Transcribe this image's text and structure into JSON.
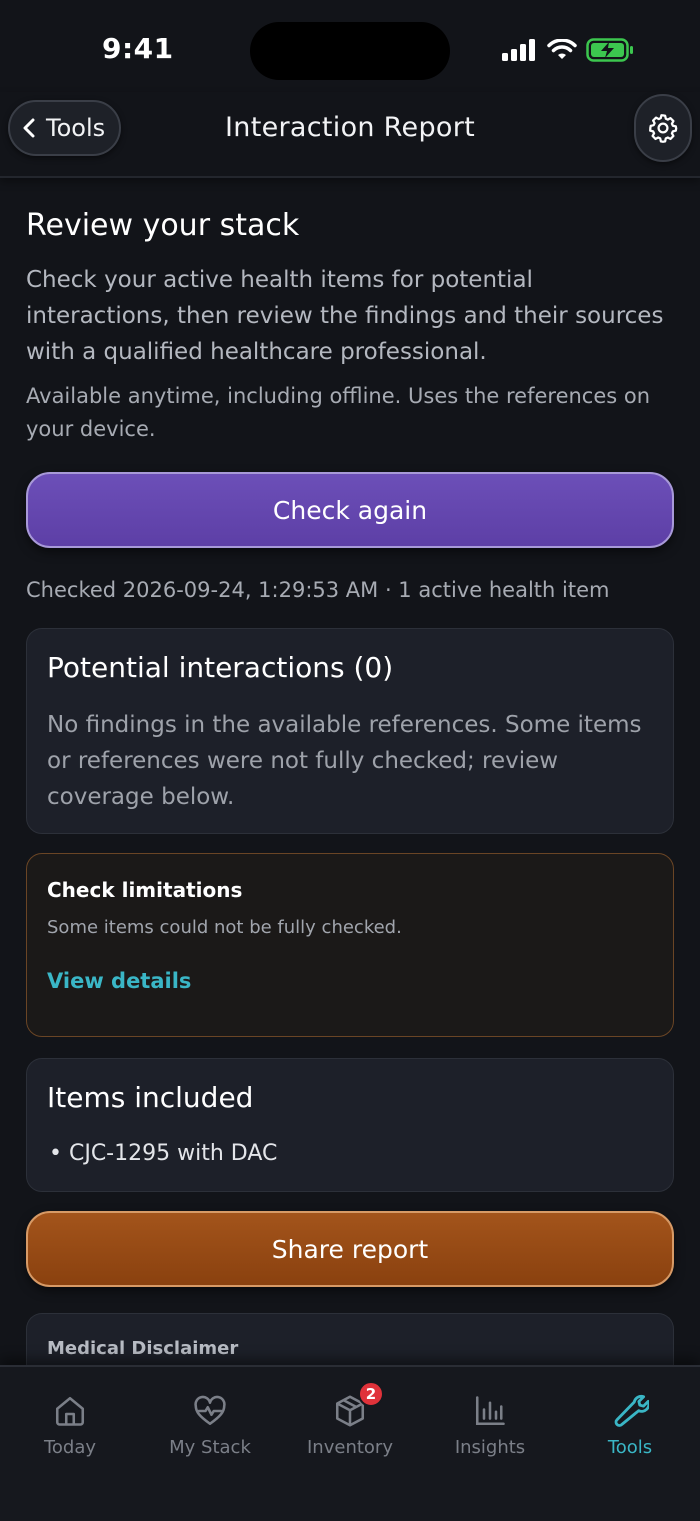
{
  "status_bar": {
    "time": "9:41"
  },
  "nav": {
    "back_label": "Tools",
    "title": "Interaction Report"
  },
  "main": {
    "heading": "Review your stack",
    "intro": "Check your active health items for potential interactions, then review the findings and their sources with a qualified healthcare professional.",
    "availability": "Available anytime, including offline. Uses the references on your device.",
    "check_button": "Check again",
    "checked_line": "Checked 2026-09-24, 1:29:53 AM · 1 active health item"
  },
  "interactions_card": {
    "title": "Potential interactions (0)",
    "body": "No findings in the available references. Some items or references were not fully checked; review coverage below."
  },
  "limitations_card": {
    "title": "Check limitations",
    "body": "Some items could not be fully checked.",
    "link": "View details"
  },
  "items_card": {
    "title": "Items included",
    "items": [
      "• CJC-1295 with DAC"
    ]
  },
  "share_button": "Share report",
  "disclaimer_card": {
    "title": "Medical Disclaimer"
  },
  "tabbar": {
    "tabs": [
      {
        "label": "Today",
        "icon": "home-icon",
        "active": false
      },
      {
        "label": "My Stack",
        "icon": "heart-pulse-icon",
        "active": false
      },
      {
        "label": "Inventory",
        "icon": "box-icon",
        "active": false,
        "badge": "2"
      },
      {
        "label": "Insights",
        "icon": "bar-chart-icon",
        "active": false
      },
      {
        "label": "Tools",
        "icon": "wrench-icon",
        "active": true
      }
    ]
  },
  "colors": {
    "background": "#121419",
    "primary_button": "#6c4fb8",
    "share_button": "#a3541b",
    "accent": "#3ab6c6",
    "badge": "#e0323a",
    "limitations_border": "#6a4525"
  }
}
